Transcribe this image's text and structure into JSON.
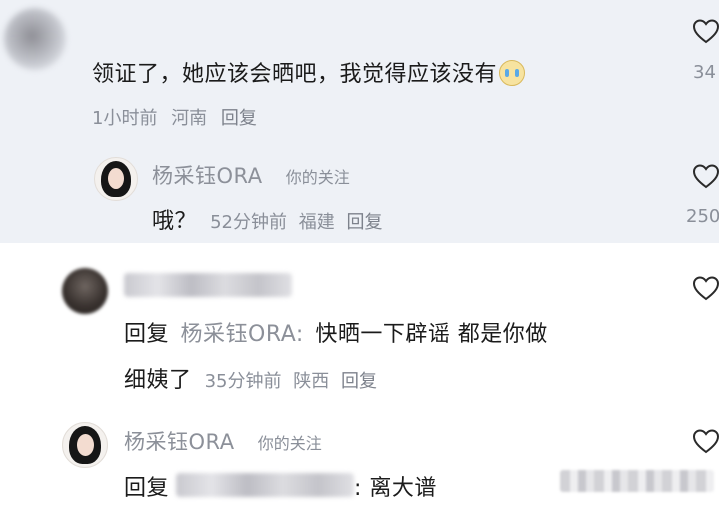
{
  "comment": {
    "text": "领证了，她应该会晒吧，我觉得应该没有",
    "time": "1小时前",
    "location": "河南",
    "reply_label": "回复",
    "like_count": "34"
  },
  "reply1": {
    "author": "杨采钰ORA",
    "tag": "你的关注",
    "text": "哦？",
    "time": "52分钟前",
    "location": "福建",
    "reply_label": "回复",
    "like_count": "250"
  },
  "reply2": {
    "prefix": "回复",
    "mention": "杨采钰ORA:",
    "line1": "快晒一下辟谣 都是你做",
    "line2": "细姨了",
    "time": "35分钟前",
    "location": "陕西",
    "reply_label": "回复"
  },
  "reply3": {
    "author": "杨采钰ORA",
    "tag": "你的关注",
    "prefix": "回复",
    "suffix": ": 离大谱"
  },
  "icons": {
    "heart": "heart-outline-icon",
    "emoji": "crying-laugh-emoji-icon"
  },
  "colors": {
    "top_background": "#eef1f6",
    "meta_text": "#8a8f99",
    "name_text": "#8c9099"
  }
}
